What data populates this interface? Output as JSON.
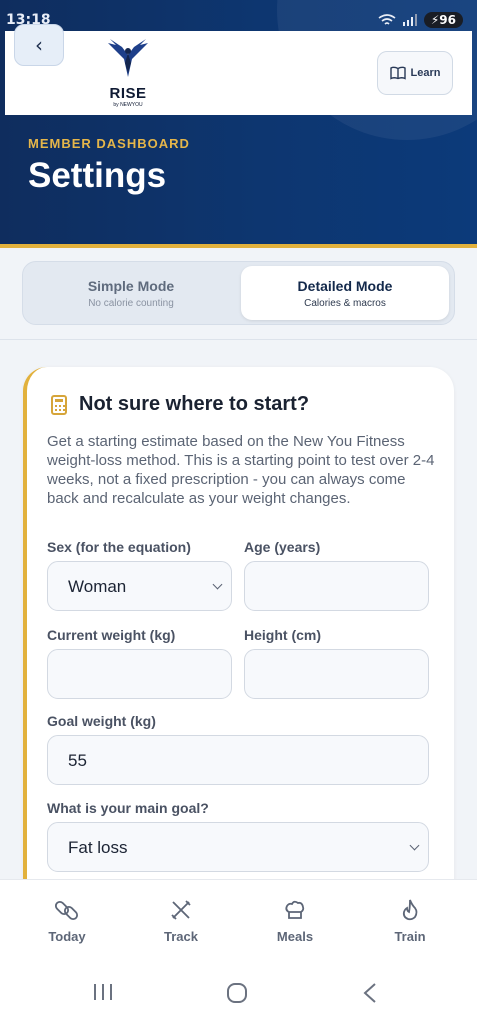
{
  "status_bar": {
    "time": "13:18",
    "battery": "96"
  },
  "header": {
    "back_icon": "chevron-left-icon",
    "logo": {
      "text": "RISE",
      "sub": "by NEWYOU"
    },
    "learn_label": "Learn",
    "learn_icon": "book-icon",
    "eyebrow": "MEMBER DASHBOARD",
    "title": "Settings",
    "colors": {
      "hero": "#0f2d5e",
      "accent": "#e2b13c"
    }
  },
  "mode_toggle": {
    "simple": {
      "title": "Simple Mode",
      "subtitle": "No calorie counting"
    },
    "detailed": {
      "title": "Detailed Mode",
      "subtitle": "Calories & macros",
      "selected": true
    }
  },
  "calculator_card": {
    "icon": "calculator-icon",
    "title": "Not sure where to start?",
    "description": "Get a starting estimate based on the New You Fitness weight-loss method. This is a starting point to test over 2-4 weeks, not a fixed prescription - you can always come back and recalculate as your weight changes.",
    "sex": {
      "label": "Sex (for the equation)",
      "value": "Woman"
    },
    "age": {
      "label": "Age (years)",
      "value": ""
    },
    "current_weight": {
      "label": "Current weight (kg)",
      "value": ""
    },
    "height": {
      "label": "Height (cm)",
      "value": ""
    },
    "goal_weight": {
      "label": "Goal weight (kg)",
      "value": "55"
    },
    "main_goal": {
      "label": "What is your main goal?",
      "value": "Fat loss"
    }
  },
  "bottom_nav": [
    {
      "label": "Today",
      "icon": "pills-icon"
    },
    {
      "label": "Track",
      "icon": "utensils-icon"
    },
    {
      "label": "Meals",
      "icon": "chef-hat-icon"
    },
    {
      "label": "Train",
      "icon": "flame-icon"
    }
  ]
}
